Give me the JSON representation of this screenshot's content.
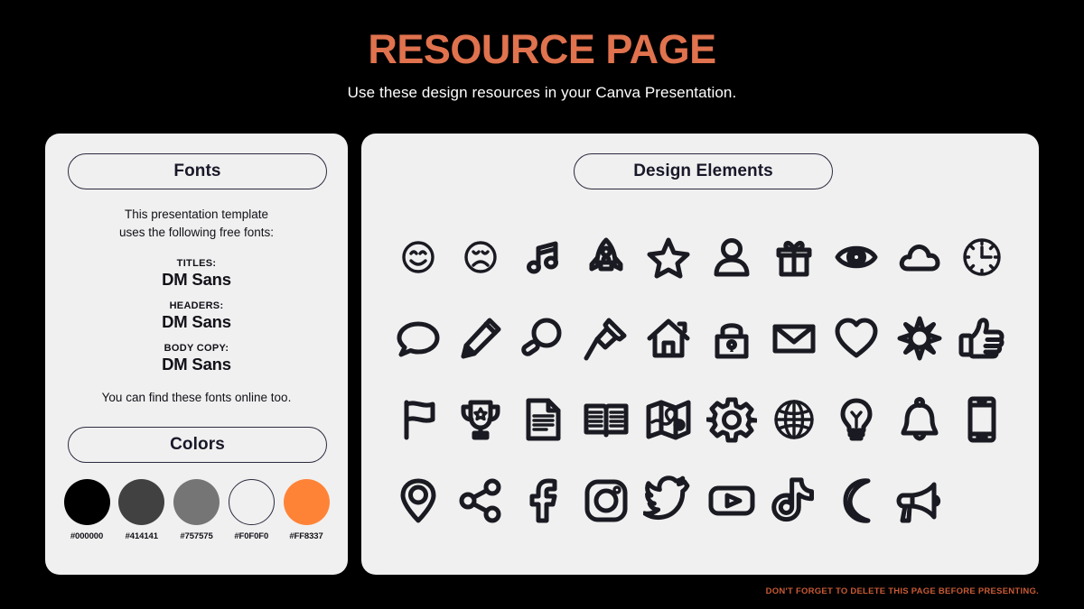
{
  "header": {
    "title": "RESOURCE PAGE",
    "subtitle": "Use these design resources in your Canva Presentation."
  },
  "left_panel": {
    "fonts_pill_label": "Fonts",
    "intro_text": "This presentation template\nuses the following free fonts:",
    "font_groups": [
      {
        "label": "TITLES:",
        "name": "DM Sans"
      },
      {
        "label": "HEADERS:",
        "name": "DM Sans"
      },
      {
        "label": "BODY COPY:",
        "name": "DM Sans"
      }
    ],
    "outro_text": "You can find these fonts online too.",
    "colors_pill_label": "Colors",
    "swatches": [
      {
        "hex": "#000000",
        "label": "#000000",
        "outlined": false
      },
      {
        "hex": "#414141",
        "label": "#414141",
        "outlined": false
      },
      {
        "hex": "#757575",
        "label": "#757575",
        "outlined": false
      },
      {
        "hex": "#F0F0F0",
        "label": "#F0F0F0",
        "outlined": true
      },
      {
        "hex": "#FF8337",
        "label": "#FF8337",
        "outlined": false
      }
    ]
  },
  "right_panel": {
    "elements_pill_label": "Design Elements",
    "icons": [
      "smiley-face-icon",
      "sad-face-icon",
      "music-note-icon",
      "rocket-icon",
      "star-icon",
      "person-icon",
      "gift-icon",
      "eye-icon",
      "cloud-icon",
      "clock-icon",
      "speech-bubble-icon",
      "pencil-icon",
      "magnifying-glass-icon",
      "pushpin-icon",
      "house-icon",
      "padlock-icon",
      "envelope-icon",
      "heart-icon",
      "sun-icon",
      "thumbs-up-icon",
      "flag-icon",
      "trophy-icon",
      "document-icon",
      "open-book-icon",
      "map-icon",
      "gear-icon",
      "globe-icon",
      "lightbulb-icon",
      "bell-icon",
      "smartphone-icon",
      "location-pin-icon",
      "share-icon",
      "facebook-icon",
      "instagram-icon",
      "twitter-icon",
      "youtube-icon",
      "tiktok-icon",
      "moon-icon",
      "megaphone-icon"
    ]
  },
  "footer": {
    "note": "DON'T FORGET TO DELETE THIS PAGE BEFORE PRESENTING."
  },
  "colors": {
    "background": "#000000",
    "panel": "#F0F0F0",
    "title_accent": "#E0724E",
    "footer_accent": "#C85A35",
    "ink": "#181829"
  }
}
